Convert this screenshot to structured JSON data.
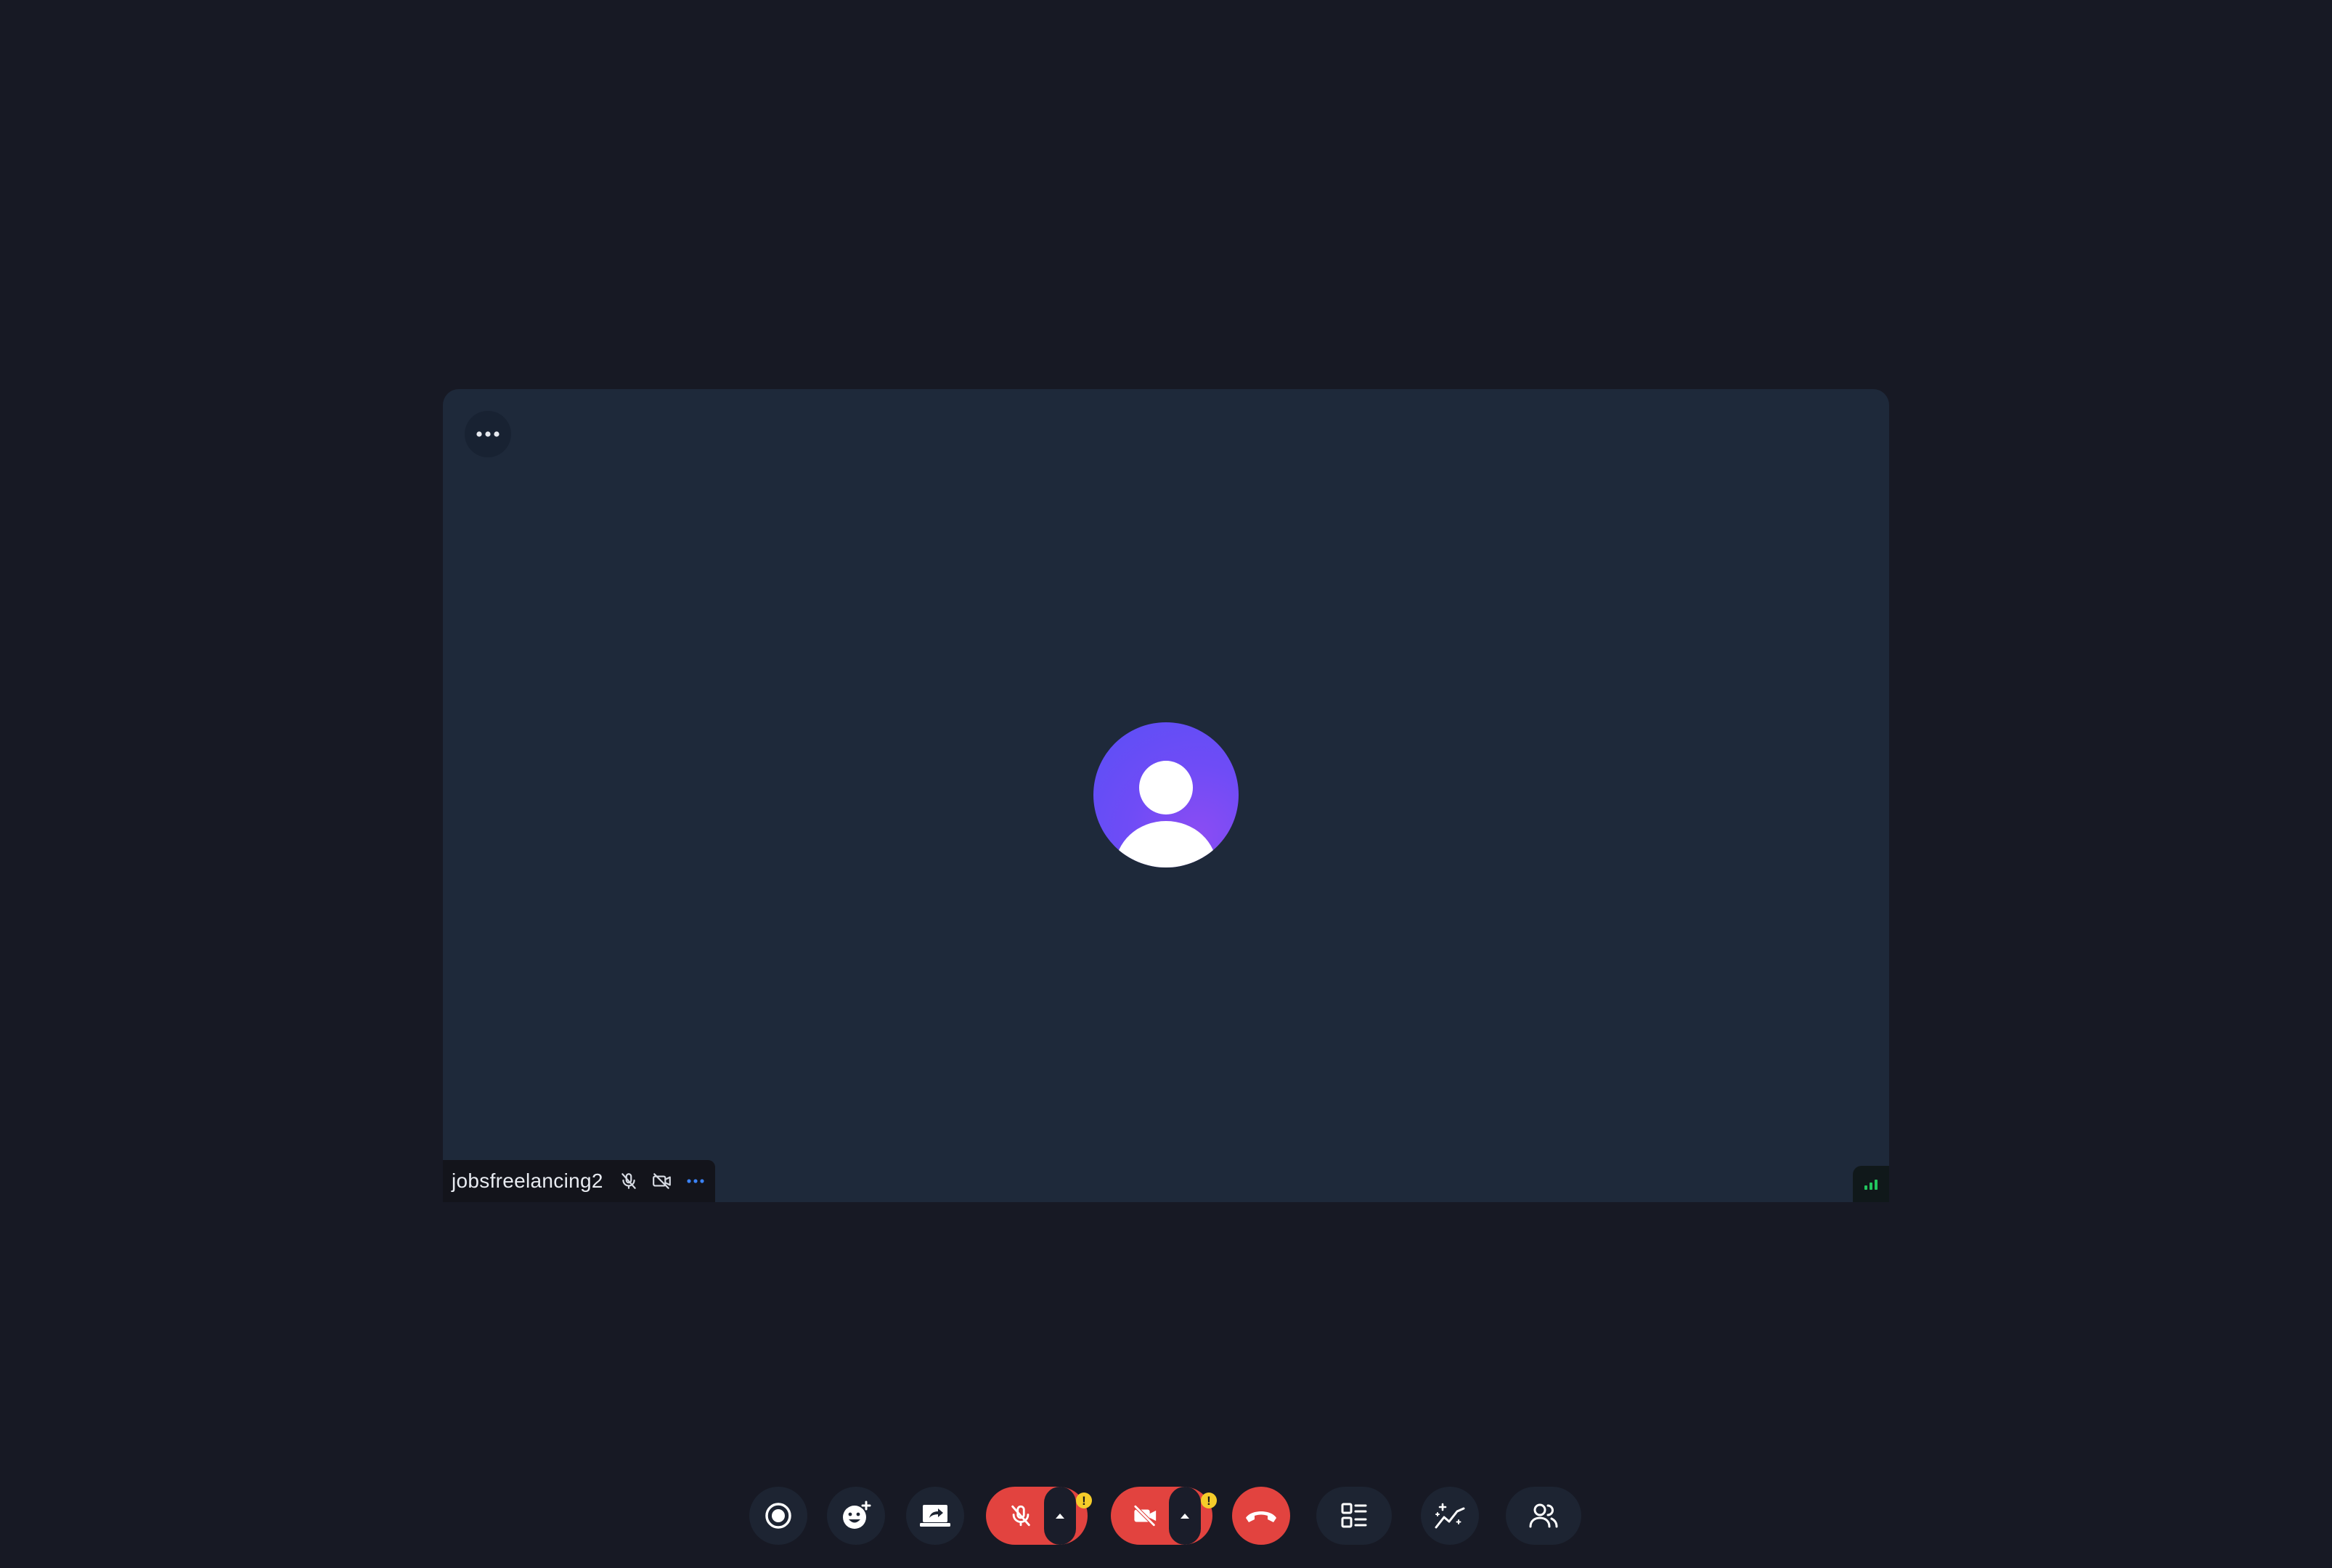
{
  "participant": {
    "name": "jobsfreelancing2",
    "mic_state": "muted",
    "camera_state": "off"
  },
  "icons": {
    "tile_menu": "more-horizontal-icon",
    "avatar": "user-silhouette-icon",
    "mic_status": "mic-off-icon",
    "camera_status": "video-off-icon",
    "participant_menu": "more-horizontal-icon",
    "connection": "signal-bars-icon"
  },
  "toolbar": {
    "buttons": [
      {
        "id": "record",
        "icon": "record-icon"
      },
      {
        "id": "reactions",
        "icon": "emoji-icon"
      },
      {
        "id": "share-screen",
        "icon": "screen-share-icon"
      },
      {
        "id": "microphone",
        "icon": "mic-off-icon",
        "state": "muted",
        "warning": "!"
      },
      {
        "id": "camera",
        "icon": "video-off-icon",
        "state": "off",
        "warning": "!"
      },
      {
        "id": "leave-call",
        "icon": "phone-hangup-icon"
      },
      {
        "id": "layout",
        "icon": "layout-list-icon"
      },
      {
        "id": "effects",
        "icon": "sparkle-chart-icon"
      },
      {
        "id": "participants",
        "icon": "people-icon"
      }
    ]
  },
  "colors": {
    "background": "#171924",
    "tile": "#1e293a",
    "danger": "#e2433f",
    "warning": "#f5cc2a",
    "accent_blue": "#3b82f6",
    "signal_green": "#22c55e",
    "avatar_gradient_start": "#5a4ff6",
    "avatar_gradient_end": "#8b4cf3"
  }
}
